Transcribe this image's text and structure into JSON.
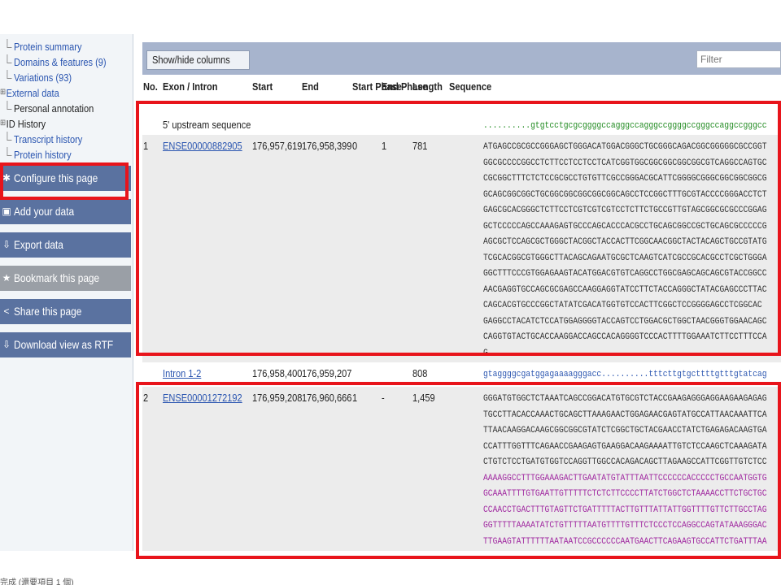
{
  "sidebar": {
    "tree": [
      {
        "label": "Protein summary",
        "level": 2,
        "link": true
      },
      {
        "label": "Domains & features (9)",
        "level": 2,
        "link": true
      },
      {
        "label": "Variations (93)",
        "level": 2,
        "link": true
      },
      {
        "label": "External data",
        "level": 1,
        "link": true,
        "expander": true
      },
      {
        "label": "Personal annotation",
        "level": 2,
        "link": false
      },
      {
        "label": "ID History",
        "level": 1,
        "link": false,
        "expander": true
      },
      {
        "label": "Transcript history",
        "level": 2,
        "link": true
      },
      {
        "label": "Protein history",
        "level": 2,
        "link": true
      }
    ],
    "actions": [
      {
        "label": "Configure this page",
        "icon": "gear-icon",
        "disabled": false
      },
      {
        "label": "Add your data",
        "icon": "add-document-icon",
        "disabled": false
      },
      {
        "label": "Export data",
        "icon": "export-icon",
        "disabled": false
      },
      {
        "label": "Bookmark this page",
        "icon": "bookmark-icon",
        "disabled": true
      },
      {
        "label": "Share this page",
        "icon": "share-icon",
        "disabled": false
      },
      {
        "label": "Download view as RTF",
        "icon": "download-icon",
        "disabled": false
      }
    ],
    "status_text": "完成 (還要項目 1 個)"
  },
  "toolbar": {
    "show_hide_label": "Show/hide columns",
    "filter_placeholder": "Filter"
  },
  "columns": [
    "No.",
    "Exon / Intron",
    "Start",
    "End",
    "Start Phase",
    "End Phase",
    "Length",
    "Sequence"
  ],
  "rows": [
    {
      "no": "",
      "name": "5' upstream sequence",
      "link": false,
      "start": "",
      "end": "",
      "start_phase": "",
      "end_phase": "",
      "length": "",
      "seq": [
        {
          "text": "..........gtgtcctgcgcggggccagggccagggccggggccgggccaggccgggcc",
          "color": "#1f8a1f"
        }
      ]
    },
    {
      "no": "1",
      "name": "ENSE00000882905",
      "link": true,
      "start": "176,957,619",
      "end": "176,958,399",
      "start_phase": "0",
      "end_phase": "1",
      "length": "781",
      "seq": [
        {
          "text": "ATGAGCCGCGCCGGGAGCTGGGACATGGACGGGCTGCGGGCAGACGGCGGGGGCGCCGGT",
          "color": "#333333"
        },
        {
          "text": "GGCGCCCCGGCCTCTTCCTCCTCCTCATCGGTGGCGGCGGCGGCGGCGTCAGGCCAGTGC",
          "color": "#333333"
        },
        {
          "text": "CGCGGCTTTCTCTCCGCGCCTGTGTTCGCCGGGACGCATTCGGGGCGGGCGGCGGCGGCG",
          "color": "#333333"
        },
        {
          "text": "GCAGCGGCGGCTGCGGCGGCGGCGGCGGCAGCCTCCGGCTTTGCGTACCCCGGGACCTCT",
          "color": "#333333"
        },
        {
          "text": "GAGCGCACGGGCTCTTCCTCGTCGTCGTCCTCTTCTGCCGTTGTAGCGGCGCGCCCGGAG",
          "color": "#333333"
        },
        {
          "text": "GCTCCCCCAGCCAAAGAGTGCCCAGCACCCACGCCTGCAGCGGCCGCTGCAGCGCCCCCG",
          "color": "#333333"
        },
        {
          "text": "AGCGCTCCAGCGCTGGGCTACGGCTACCACTTCGGCAACGGCTACTACAGCTGCCGTATG",
          "color": "#333333"
        },
        {
          "text": "TCGCACGGCGTGGGCTTACAGCAGAATGCGCTCAAGTCATCGCCGCACGCCTCGCTGGGA",
          "color": "#333333"
        },
        {
          "text": "GGCTTTCCCGTGGAGAAGTACATGGACGTGTCAGGCCTGGCGAGCAGCAGCGTACCGGCC",
          "color": "#333333"
        },
        {
          "text": "AACGAGGTGCCAGCGCGAGCCAAGGAGGTATCCTTCTACCAGGGCTATACGAGCCCTTAC",
          "color": "#333333"
        },
        {
          "text": "CAGCACGTGCCCGGCTATATCGACATGGTGTCCACTTCGGCTCCGGGGAGCCTCGGCAC",
          "color": "#333333"
        },
        {
          "text": "GAGGCCTACATCTCCATGGAGGGGTACCAGTCCTGGACGCTGGCTAACGGGTGGAACAGC",
          "color": "#333333"
        },
        {
          "text": "CAGGTGTACTGCACCAAGGACCAGCCACAGGGGTCCCACTTTTGGAAATCTTCCTTTCCA",
          "color": "#333333"
        },
        {
          "text": "G",
          "color": "#333333"
        }
      ]
    },
    {
      "no": "",
      "name": "Intron 1-2",
      "link": true,
      "start": "176,958,400",
      "end": "176,959,207",
      "start_phase": "",
      "end_phase": "",
      "length": "808",
      "seq": [
        {
          "text": "gtaggggcgatggagaaaagggacc..........tttcttgtgcttttgtttgtatcag",
          "color": "#2a55b0"
        }
      ]
    },
    {
      "no": "2",
      "name": "ENSE00001272192",
      "link": true,
      "start": "176,959,208",
      "end": "176,960,666",
      "start_phase": "1",
      "end_phase": "-",
      "length": "1,459",
      "seq": [
        {
          "text": "GGGATGTGGCTCTAAATCAGCCGGACATGTGCGTCTACCGAAGAGGGAGGAAGAAGAGAG",
          "color": "#333333"
        },
        {
          "text": "TGCCTTACACCAAACTGCAGCTTAAAGAACTGGAGAACGAGTATGCCATTAACAAATTCA",
          "color": "#333333"
        },
        {
          "text": "TTAACAAGGACAAGCGGCGGCGTATCTCGGCTGCTACGAACCTATCTGAGAGACAAGTGA",
          "color": "#333333"
        },
        {
          "text": "CCATTTGGTTTCAGAACCGAAGAGTGAAGGACAAGAAAATTGTCTCCAAGCTCAAAGATA",
          "color": "#333333"
        },
        {
          "text": "CTGTCTCCTGATGTGGTCCAGGTTGGCCACAGACAGCTTAGAAGCCATTCGGTTGTCTCC",
          "color": "#333333"
        },
        {
          "text": "AAAAGGCCTTTGGAAAGACTTGAATATGTATTTAATTCCCCCCACCCCCTGCCAATGGTG",
          "color": "#a028a0"
        },
        {
          "text": "GCAAATTTTGTGAATTGTTTTTCTCTCTTCCCCTTATCTGGCTCTAAAACCTTCTGCTGC",
          "color": "#a028a0"
        },
        {
          "text": "CCAACCTGACTTTGTAGTTCTGATTTTTACTTGTTTATTATTGGTTTTGTTCTTGCCTAG",
          "color": "#a028a0"
        },
        {
          "text": "GGTTTTTAAAATATCTGTTTTTAATGTTTTGTTTCTCCCTCCAGGCCAGTATAAAGGGAC",
          "color": "#a028a0"
        },
        {
          "text": "TTGAAGTATTTTTTAATAATCCGCCCCCCAATGAACTTCAGAAGTGCCATTCTGATTTAA",
          "color": "#a028a0"
        }
      ]
    }
  ]
}
